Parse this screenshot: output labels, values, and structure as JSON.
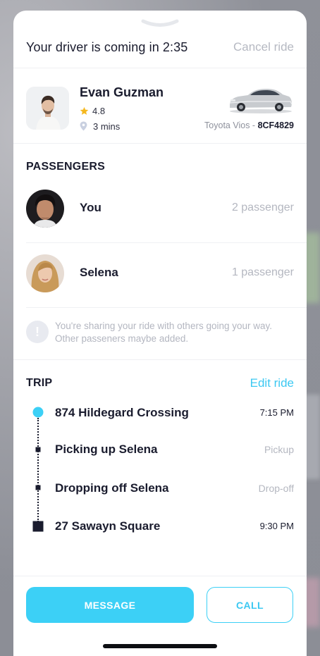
{
  "header": {
    "title": "Your driver is coming in 2:35",
    "cancel_label": "Cancel ride"
  },
  "driver": {
    "name": "Evan Guzman",
    "rating": "4.8",
    "eta": "3 mins",
    "car_model": "Toyota Vios",
    "car_separator": " - ",
    "plate": "8CF4829"
  },
  "passengers": {
    "title": "PASSENGERS",
    "items": [
      {
        "name": "You",
        "count": "2 passenger"
      },
      {
        "name": "Selena",
        "count": "1 passenger"
      }
    ],
    "notice_lines": [
      "You're sharing your ride with others going your way.",
      "Other passeners maybe added."
    ]
  },
  "trip": {
    "title": "TRIP",
    "edit_label": "Edit ride",
    "stops": [
      {
        "name": "874 Hildegard Crossing",
        "time": "7:15 PM"
      },
      {
        "name": "Picking up Selena",
        "time": "Pickup"
      },
      {
        "name": "Dropping off Selena",
        "time": "Drop-off"
      },
      {
        "name": "27 Sawayn Square",
        "time": "9:30 PM"
      }
    ]
  },
  "actions": {
    "message_label": "MESSAGE",
    "call_label": "CALL"
  },
  "colors": {
    "accent": "#3cd0f6",
    "text": "#1a1c2e",
    "muted": "#b4b7c0",
    "star": "#f5b81f"
  },
  "icons": {
    "handle": "chevron-down-icon",
    "rating": "star-icon",
    "eta": "location-pin-icon",
    "notice": "info-icon"
  }
}
